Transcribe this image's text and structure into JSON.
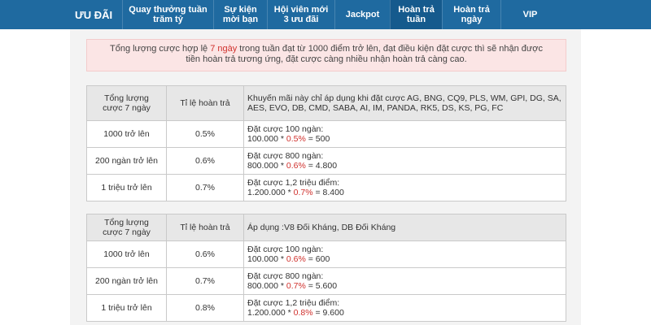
{
  "nav": {
    "title": "ƯU ĐÃI",
    "items": [
      {
        "line1": "Quay thưởng tuần",
        "line2": "trăm tỷ"
      },
      {
        "line1": "Sự kiện",
        "line2": "mời bạn"
      },
      {
        "line1": "Hội viên mới",
        "line2": "3 ưu đãi"
      },
      {
        "line1": "Jackpot",
        "line2": ""
      },
      {
        "line1": "Hoàn trả",
        "line2": "tuần"
      },
      {
        "line1": "Hoàn trả",
        "line2": "ngày"
      },
      {
        "line1": "VIP",
        "line2": ""
      }
    ],
    "active_index": 4
  },
  "notice": {
    "part1": "Tổng lượng cược hợp lệ ",
    "highlight": "7 ngày",
    "part2": " trong tuần đạt từ 1000 điểm trở lên, đạt điều kiện đặt cược thì sẽ nhận được",
    "line2": "tiền hoàn trả tương ứng, đặt cược càng nhiều nhận hoàn trả càng cao."
  },
  "tables": [
    {
      "header": {
        "col1_line1": "Tổng lượng",
        "col1_line2": "cược 7 ngày",
        "col2": "Tỉ lệ hoàn trả",
        "note": "Khuyến mãi này chỉ áp dụng khi đặt cược AG, BNG, CQ9, PLS, WM, GPI, DG, SA, AES, EVO, DB, CMD, SABA, AI, IM, PANDA, RK5, DS, KS, PG, FC"
      },
      "rows": [
        {
          "tier": "1000 trở lên",
          "rate": "0.5%",
          "ex_title": "Đặt cược 100 ngàn:",
          "ex_base": "100.000 * ",
          "ex_rate": "0.5%",
          "ex_result": " = 500"
        },
        {
          "tier": "200 ngàn trở lên",
          "rate": "0.6%",
          "ex_title": "Đặt cược 800 ngàn:",
          "ex_base": "800.000 * ",
          "ex_rate": "0.6%",
          "ex_result": " = 4.800"
        },
        {
          "tier": "1 triệu trở lên",
          "rate": "0.7%",
          "ex_title": "Đặt cược 1,2 triệu điểm:",
          "ex_base": "1.200.000 * ",
          "ex_rate": "0.7%",
          "ex_result": " = 8.400"
        }
      ]
    },
    {
      "header": {
        "col1_line1": "Tổng lượng",
        "col1_line2": "cược 7 ngày",
        "col2": "Tỉ lệ hoàn trả",
        "note": "Áp dụng :V8 Đối Kháng, DB Đối Kháng"
      },
      "rows": [
        {
          "tier": "1000 trở lên",
          "rate": "0.6%",
          "ex_title": "Đặt cược 100 ngàn:",
          "ex_base": "100.000 * ",
          "ex_rate": "0.6%",
          "ex_result": " = 600"
        },
        {
          "tier": "200 ngàn trở lên",
          "rate": "0.7%",
          "ex_title": "Đặt cược 800 ngàn:",
          "ex_base": "800.000 * ",
          "ex_rate": "0.7%",
          "ex_result": " = 5.600"
        },
        {
          "tier": "1 triệu trở lên",
          "rate": "0.8%",
          "ex_title": "Đặt cược 1,2 triệu điểm:",
          "ex_base": "1.200.000 * ",
          "ex_rate": "0.8%",
          "ex_result": " = 9.600"
        }
      ]
    }
  ],
  "colors": {
    "nav_bg": "#1f6aa0",
    "nav_active": "#155a8d",
    "highlight": "#d0312d",
    "notice_bg": "#fbe5e5"
  }
}
